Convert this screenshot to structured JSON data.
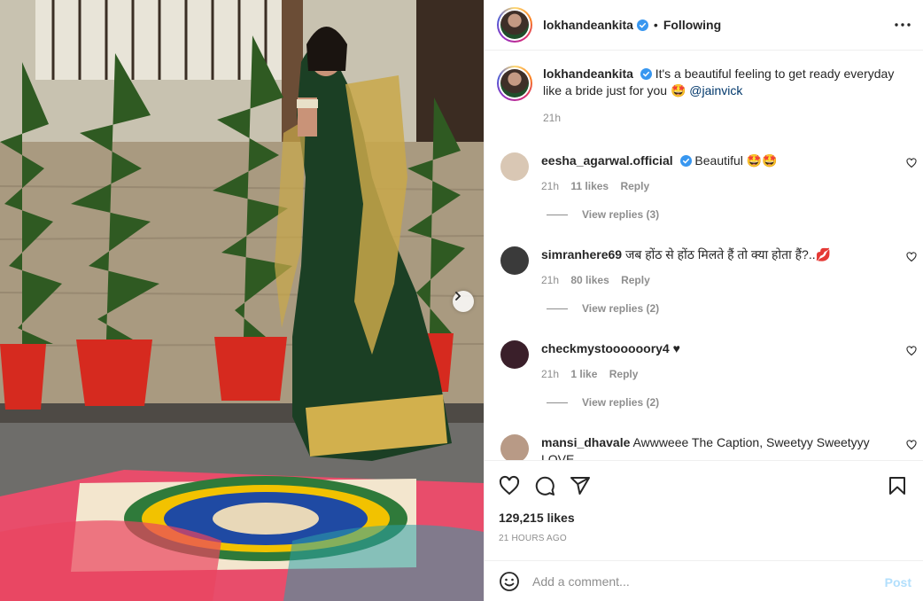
{
  "post": {
    "author": "lokhandeankita",
    "follow_status": "Following",
    "dot": "•",
    "caption": "It's a beautiful feeling to get ready everyday like a bride just for you 🤩",
    "caption_mention": "@jainvick",
    "caption_time": "21h",
    "likes": "129,215 likes",
    "posted_ago": "21 HOURS AGO"
  },
  "comments": [
    {
      "user": "eesha_agarwal.official",
      "verified": true,
      "text": "Beautiful 🤩🤩",
      "time": "21h",
      "likes": "11 likes",
      "reply_label": "Reply",
      "view_replies": "View replies (3)",
      "avatar_color": "#d9c7b4"
    },
    {
      "user": "simranhere69",
      "verified": false,
      "text": "जब होंठ से होंठ मिलते हैं तो क्या होता हैं?..💋",
      "time": "21h",
      "likes": "80 likes",
      "reply_label": "Reply",
      "view_replies": "View replies (2)",
      "avatar_color": "#3a3a3a"
    },
    {
      "user": "checkmystoooooory4",
      "verified": false,
      "text": "♥",
      "time": "21h",
      "likes": "1 like",
      "reply_label": "Reply",
      "view_replies": "View replies (2)",
      "avatar_color": "#3a1f2a"
    },
    {
      "user": "mansi_dhavale",
      "verified": false,
      "text": "Awwweee The Caption, Sweetyy Sweetyyy LOVE",
      "avatar_color": "#b89a86"
    }
  ],
  "add_comment": {
    "placeholder": "Add a comment...",
    "post_label": "Post"
  },
  "icons": {
    "more": "more-horizontal-icon",
    "like": "heart-icon",
    "comment": "comment-icon",
    "share": "share-icon",
    "save": "bookmark-icon",
    "emoji": "emoji-icon",
    "next": "chevron-right-icon"
  },
  "colors": {
    "verified": "#3897f0",
    "mention": "#00376b",
    "muted": "#8e8e8e",
    "post_disabled": "#b2dffc"
  }
}
